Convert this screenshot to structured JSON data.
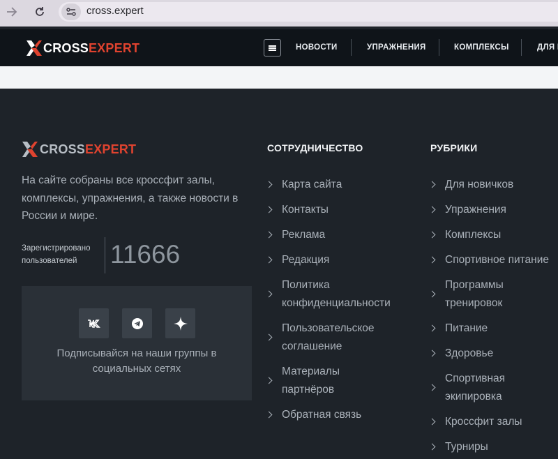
{
  "browser": {
    "url": "cross.expert"
  },
  "header": {
    "logo_cross": "CROSS",
    "logo_expert": "EXPERT",
    "nav": [
      "НОВОСТИ",
      "УПРАЖНЕНИЯ",
      "КОМПЛЕКСЫ",
      "ДЛЯ Н"
    ]
  },
  "footer": {
    "logo_cross": "CROSS",
    "logo_expert": "EXPERT",
    "description": "На сайте собраны все кроссфит залы, комплексы, упражнения, а также новости в России и мире.",
    "registered_label_1": "Зарегистрировано",
    "registered_label_2": "пользователей",
    "registered_count": "11666",
    "social_icons": [
      "vk-icon",
      "telegram-icon",
      "sparkle-icon"
    ],
    "social_text": "Подписывайся на наши группы в социальных сетях",
    "col1_title": "СОТРУДНИЧЕСТВО",
    "col1_links": [
      {
        "l1": "Карта сайта"
      },
      {
        "l1": "Контакты"
      },
      {
        "l1": "Реклама"
      },
      {
        "l1": "Редакция"
      },
      {
        "l1": "Политика",
        "l2": "конфиденциальности"
      },
      {
        "l1": "Пользовательское",
        "l2": "соглашение"
      },
      {
        "l1": "Материалы",
        "l2": "партнёров"
      },
      {
        "l1": "Обратная связь"
      }
    ],
    "col2_title": "РУБРИКИ",
    "col2_links": [
      {
        "l1": "Для новичков"
      },
      {
        "l1": "Упражнения"
      },
      {
        "l1": "Комплексы"
      },
      {
        "l1": "Спортивное питание"
      },
      {
        "l1": "Программы",
        "l2": "тренировок"
      },
      {
        "l1": "Питание"
      },
      {
        "l1": "Здоровье"
      },
      {
        "l1": "Спортивная",
        "l2": "экипировка"
      },
      {
        "l1": "Кроссфит залы"
      },
      {
        "l1": "Турниры"
      }
    ]
  },
  "colors": {
    "brand_red": "#e0432f",
    "footer_bg": "#1e2329",
    "header_bg": "#0f1419"
  }
}
